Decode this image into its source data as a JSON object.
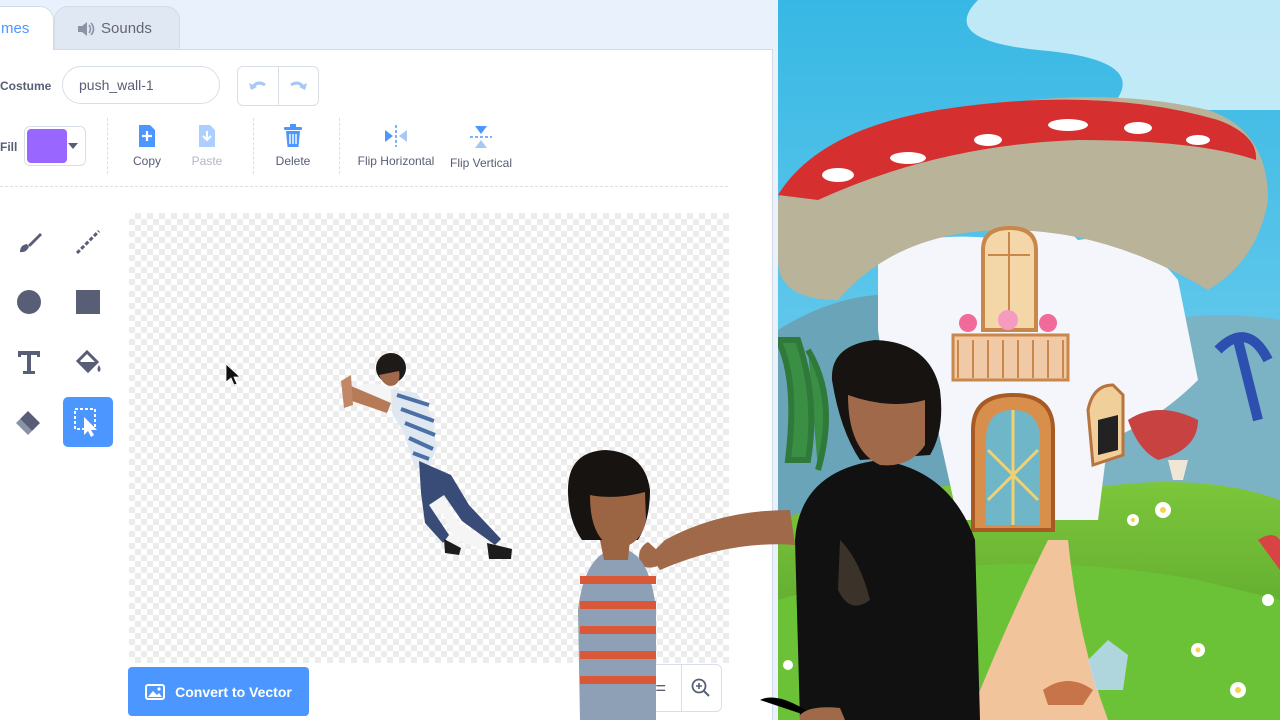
{
  "tabs": {
    "costumes": "mes",
    "sounds": "Sounds"
  },
  "costume": {
    "label": "Costume",
    "name": "push_wall-1"
  },
  "fill": {
    "label": "Fill",
    "color": "#9966ff"
  },
  "toolbar": {
    "copy": "Copy",
    "paste": "Paste",
    "delete": "Delete",
    "flip_h": "Flip Horizontal",
    "flip_v": "Flip Vertical"
  },
  "tools": [
    "brush-icon",
    "line-icon",
    "circle-icon",
    "rectangle-icon",
    "text-icon",
    "fill-icon",
    "eraser-icon",
    "select-icon"
  ],
  "selected_tool": "select-icon",
  "convert_button": "Convert to Vector",
  "zoom": {
    "reset": "=",
    "in": "zoom-in-icon"
  },
  "colors": {
    "accent": "#4c97ff",
    "text": "#575e75"
  }
}
